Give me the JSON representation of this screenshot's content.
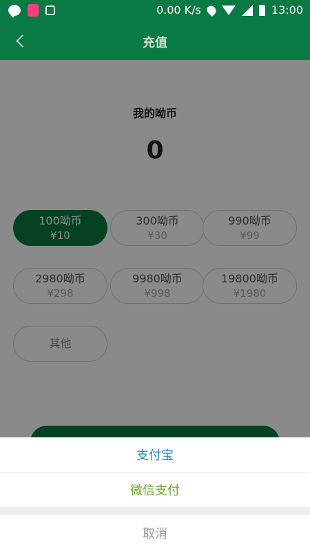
{
  "status_bar": {
    "network_speed": "0.00 K/s",
    "time": "13:00",
    "left_icons": [
      "message-icon",
      "shopping-bag-icon",
      "store-icon"
    ],
    "right_icons": [
      "location-icon",
      "wifi-icon",
      "signal-icon",
      "battery-icon"
    ]
  },
  "header": {
    "title": "充值",
    "back_icon": "chevron-left-icon"
  },
  "balance": {
    "label": "我的呦币",
    "value": "0"
  },
  "options": [
    {
      "coins": "100呦币",
      "price": "¥10",
      "selected": true
    },
    {
      "coins": "300呦币",
      "price": "¥30",
      "selected": false
    },
    {
      "coins": "990呦币",
      "price": "¥99",
      "selected": false
    },
    {
      "coins": "2980呦币",
      "price": "¥298",
      "selected": false
    },
    {
      "coins": "9980呦币",
      "price": "¥998",
      "selected": false
    },
    {
      "coins": "19800呦币",
      "price": "¥1980",
      "selected": false
    }
  ],
  "other_option": {
    "label": "其他"
  },
  "action_sheet": {
    "alipay": "支付宝",
    "wechat": "微信支付",
    "cancel": "取消"
  },
  "colors": {
    "brand_green": "#0a7a44",
    "alipay_blue": "#1e8bd4",
    "wechat_green": "#6aa925"
  }
}
